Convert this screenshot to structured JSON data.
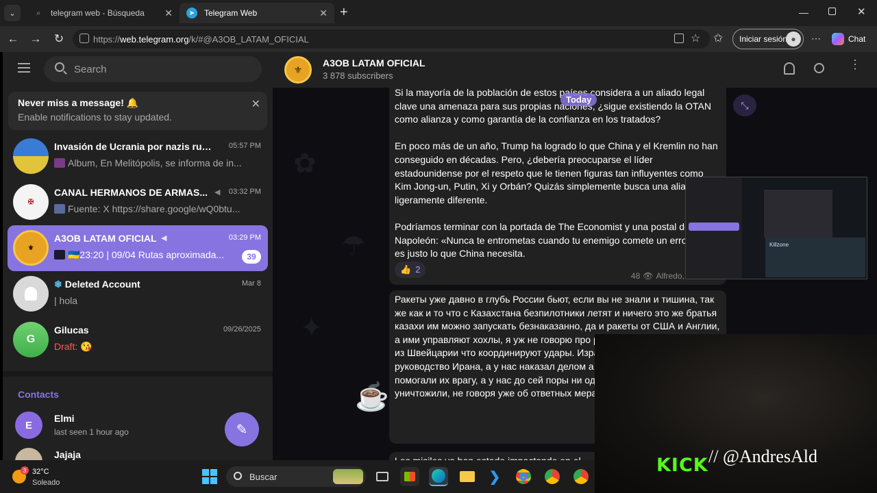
{
  "browser": {
    "tabs": [
      {
        "title": "telegram web - Búsqueda",
        "icon": "search-favicon"
      },
      {
        "title": "Telegram Web",
        "icon": "telegram-favicon"
      }
    ],
    "url_prefix": "https://",
    "url_host": "web.telegram.org",
    "url_path": "/k/#@A3OB_LATAM_OFICIAL",
    "signin_label": "Iniciar sesión",
    "chat_label": "Chat",
    "new_tab": "+"
  },
  "sidebar": {
    "search_placeholder": "Search",
    "notify_title": "Never miss a message! 🔔",
    "notify_body": "Enable notifications to stay updated.",
    "chats": [
      {
        "name": "Invasión de Ucrania por nazis ruso...",
        "time": "05:57 PM",
        "preview": "Album, En Melitópolis, se informa de in..."
      },
      {
        "name": "CANAL HERMANOS DE ARMAS...",
        "time": "03:32 PM",
        "preview": "Fuente: X https://share.google/wQ0btu..."
      },
      {
        "name": "A3OB LATAM OFICIAL",
        "time": "03:29 PM",
        "preview": "🇺🇦23:20 | 09/04 Rutas aproximada...",
        "badge": "39"
      },
      {
        "name": "Deleted Account",
        "time": "Mar 8",
        "preview": "| hola"
      },
      {
        "name": "Gilucas",
        "time": "09/26/2025",
        "draft_label": "Draft:",
        "draft_text": "😘",
        "initial": "G"
      }
    ],
    "contacts_title": "Contacts",
    "contacts": [
      {
        "name": "Elmi",
        "status": "last seen 1 hour ago",
        "initial": "E"
      },
      {
        "name": "Jajaja",
        "status": ""
      }
    ]
  },
  "channel": {
    "name": "A3OB LATAM OFICIAL",
    "subscribers": "3 878 subscribers",
    "date_chip": "Today"
  },
  "messages": {
    "m1_p1": "Si la mayoría de la población de estos países considera a un aliado legal clave una amenaza para sus propias naciones, ¿sigue existiendo la OTAN como alianza y como garantía de la confianza en los tratados?",
    "m1_p2": "En poco más de un año, Trump ha logrado lo que China y el Kremlin no han conseguido en décadas. Pero, ¿debería preocuparse el líder estadounidense por el respeto que le tienen figuras tan influyentes como Kim Jong-un, Putin, Xi y Orbán? Quizás simplemente busca una alianza ligeramente diferente.",
    "m1_p3": "Podríamos terminar con la portada de The Economist y una postal de Napoleón: «Nunca te entrometas cuando tu enemigo comete un error». Eso es justo lo que China necesita.",
    "reaction_emoji": "👍",
    "reaction_count": "2",
    "views": "48",
    "author": "Alfredo, 11:21 AM",
    "m2_text": "Ракеты уже давно в глубь России бьют, если вы не знали и тишина, так же как и то что с Казахстана безпилотники летят и ничего это же братья казахи им можно запускать безнаказанно, да и ракеты от США и Англии, а ими управляют хохлы, я уж не говорю про разведывательные данные из Швейцарии что координируют удары. Израиль уничтожил всё руководство Ирана, а у нас наказал делом а не словами все страны помогали их врагу, а у нас до сей поры ни одного со стран НАТО не уничтожили, не говоря уже об ответных мерах, в общем что писать и так",
    "m3_text": "Los misiles ya han estado impactando en el"
  },
  "overlay": {
    "kick_logo": "KICK",
    "handle": "// @AndresAld",
    "mini_label": "Killzone"
  },
  "taskbar": {
    "weather_temp": "32°C",
    "weather_desc": "Soleado",
    "weather_badge": "3",
    "search_label": "Buscar"
  }
}
